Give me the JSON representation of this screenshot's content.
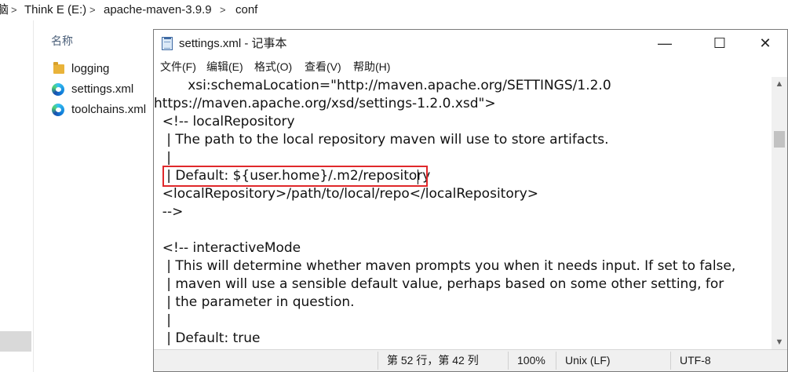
{
  "explorer": {
    "breadcrumb": [
      "脑",
      "Think E (E:)",
      "apache-maven-3.9.9",
      "conf"
    ],
    "breadcrumb_separator": ">",
    "column_header": "名称",
    "files": [
      {
        "name": "logging",
        "icon": "folder-icon"
      },
      {
        "name": "settings.xml",
        "icon": "edge-icon"
      },
      {
        "name": "toolchains.xml",
        "icon": "edge-icon"
      }
    ]
  },
  "notepad": {
    "title": "settings.xml - 记事本",
    "window_buttons": {
      "minimize": "—",
      "maximize": "☐",
      "close": "✕"
    },
    "menu": [
      "文件(F)",
      "编辑(E)",
      "格式(O)",
      "查看(V)",
      "帮助(H)"
    ],
    "lines": [
      "        xsi:schemaLocation=\"http://maven.apache.org/SETTINGS/1.2.0",
      "https://maven.apache.org/xsd/settings-1.2.0.xsd\">",
      "  <!-- localRepository",
      "   | The path to the local repository maven will use to store artifacts.",
      "   |",
      "   | Default: ${user.home}/.m2/repository",
      "  <localRepository>/path/to/local/repo</localRepository>",
      "  -->",
      "",
      "  <!-- interactiveMode",
      "   | This will determine whether maven prompts you when it needs input. If set to false,",
      "   | maven will use a sensible default value, perhaps based on some other setting, for",
      "   | the parameter in question.",
      "   |",
      "   | Default: true"
    ],
    "scroll": {
      "up": "▲",
      "down": "▼"
    },
    "status": {
      "position": "第 52 行，第 42 列",
      "zoom": "100%",
      "line_ending": "Unix (LF)",
      "encoding": "UTF-8"
    },
    "highlight_color": "#e0282b"
  }
}
